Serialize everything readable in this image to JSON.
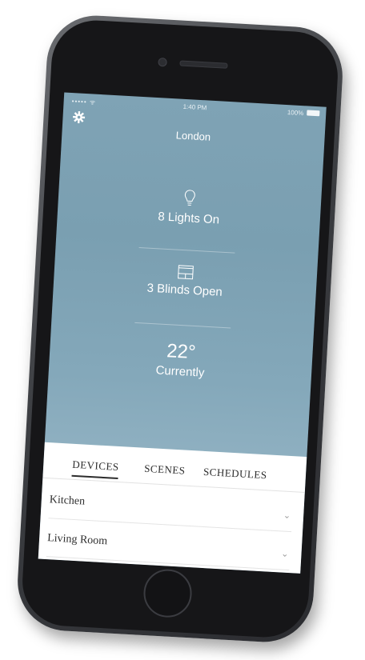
{
  "status_bar": {
    "signal": "••••• ᯤ",
    "time": "1:40 PM",
    "battery": "100%"
  },
  "header": {
    "location": "London",
    "settings_icon": "gear-icon"
  },
  "stats": {
    "lights": {
      "icon": "lightbulb-icon",
      "label": "8 Lights On"
    },
    "blinds": {
      "icon": "blinds-icon",
      "label": "3 Blinds Open"
    },
    "temperature": {
      "value": "22°",
      "label": "Currently"
    }
  },
  "tabs": [
    {
      "label": "DEVICES",
      "active": true
    },
    {
      "label": "SCENES",
      "active": false
    },
    {
      "label": "SCHEDULES",
      "active": false
    }
  ],
  "rooms": [
    {
      "label": "Kitchen",
      "icon": "chevron-down-icon"
    },
    {
      "label": "Living Room",
      "icon": "chevron-down-icon"
    }
  ],
  "colors": {
    "background_blue": "#7fa3b5",
    "panel": "#ffffff",
    "phone_body": "#3c3e42",
    "text_dark": "#2c2c2c"
  }
}
